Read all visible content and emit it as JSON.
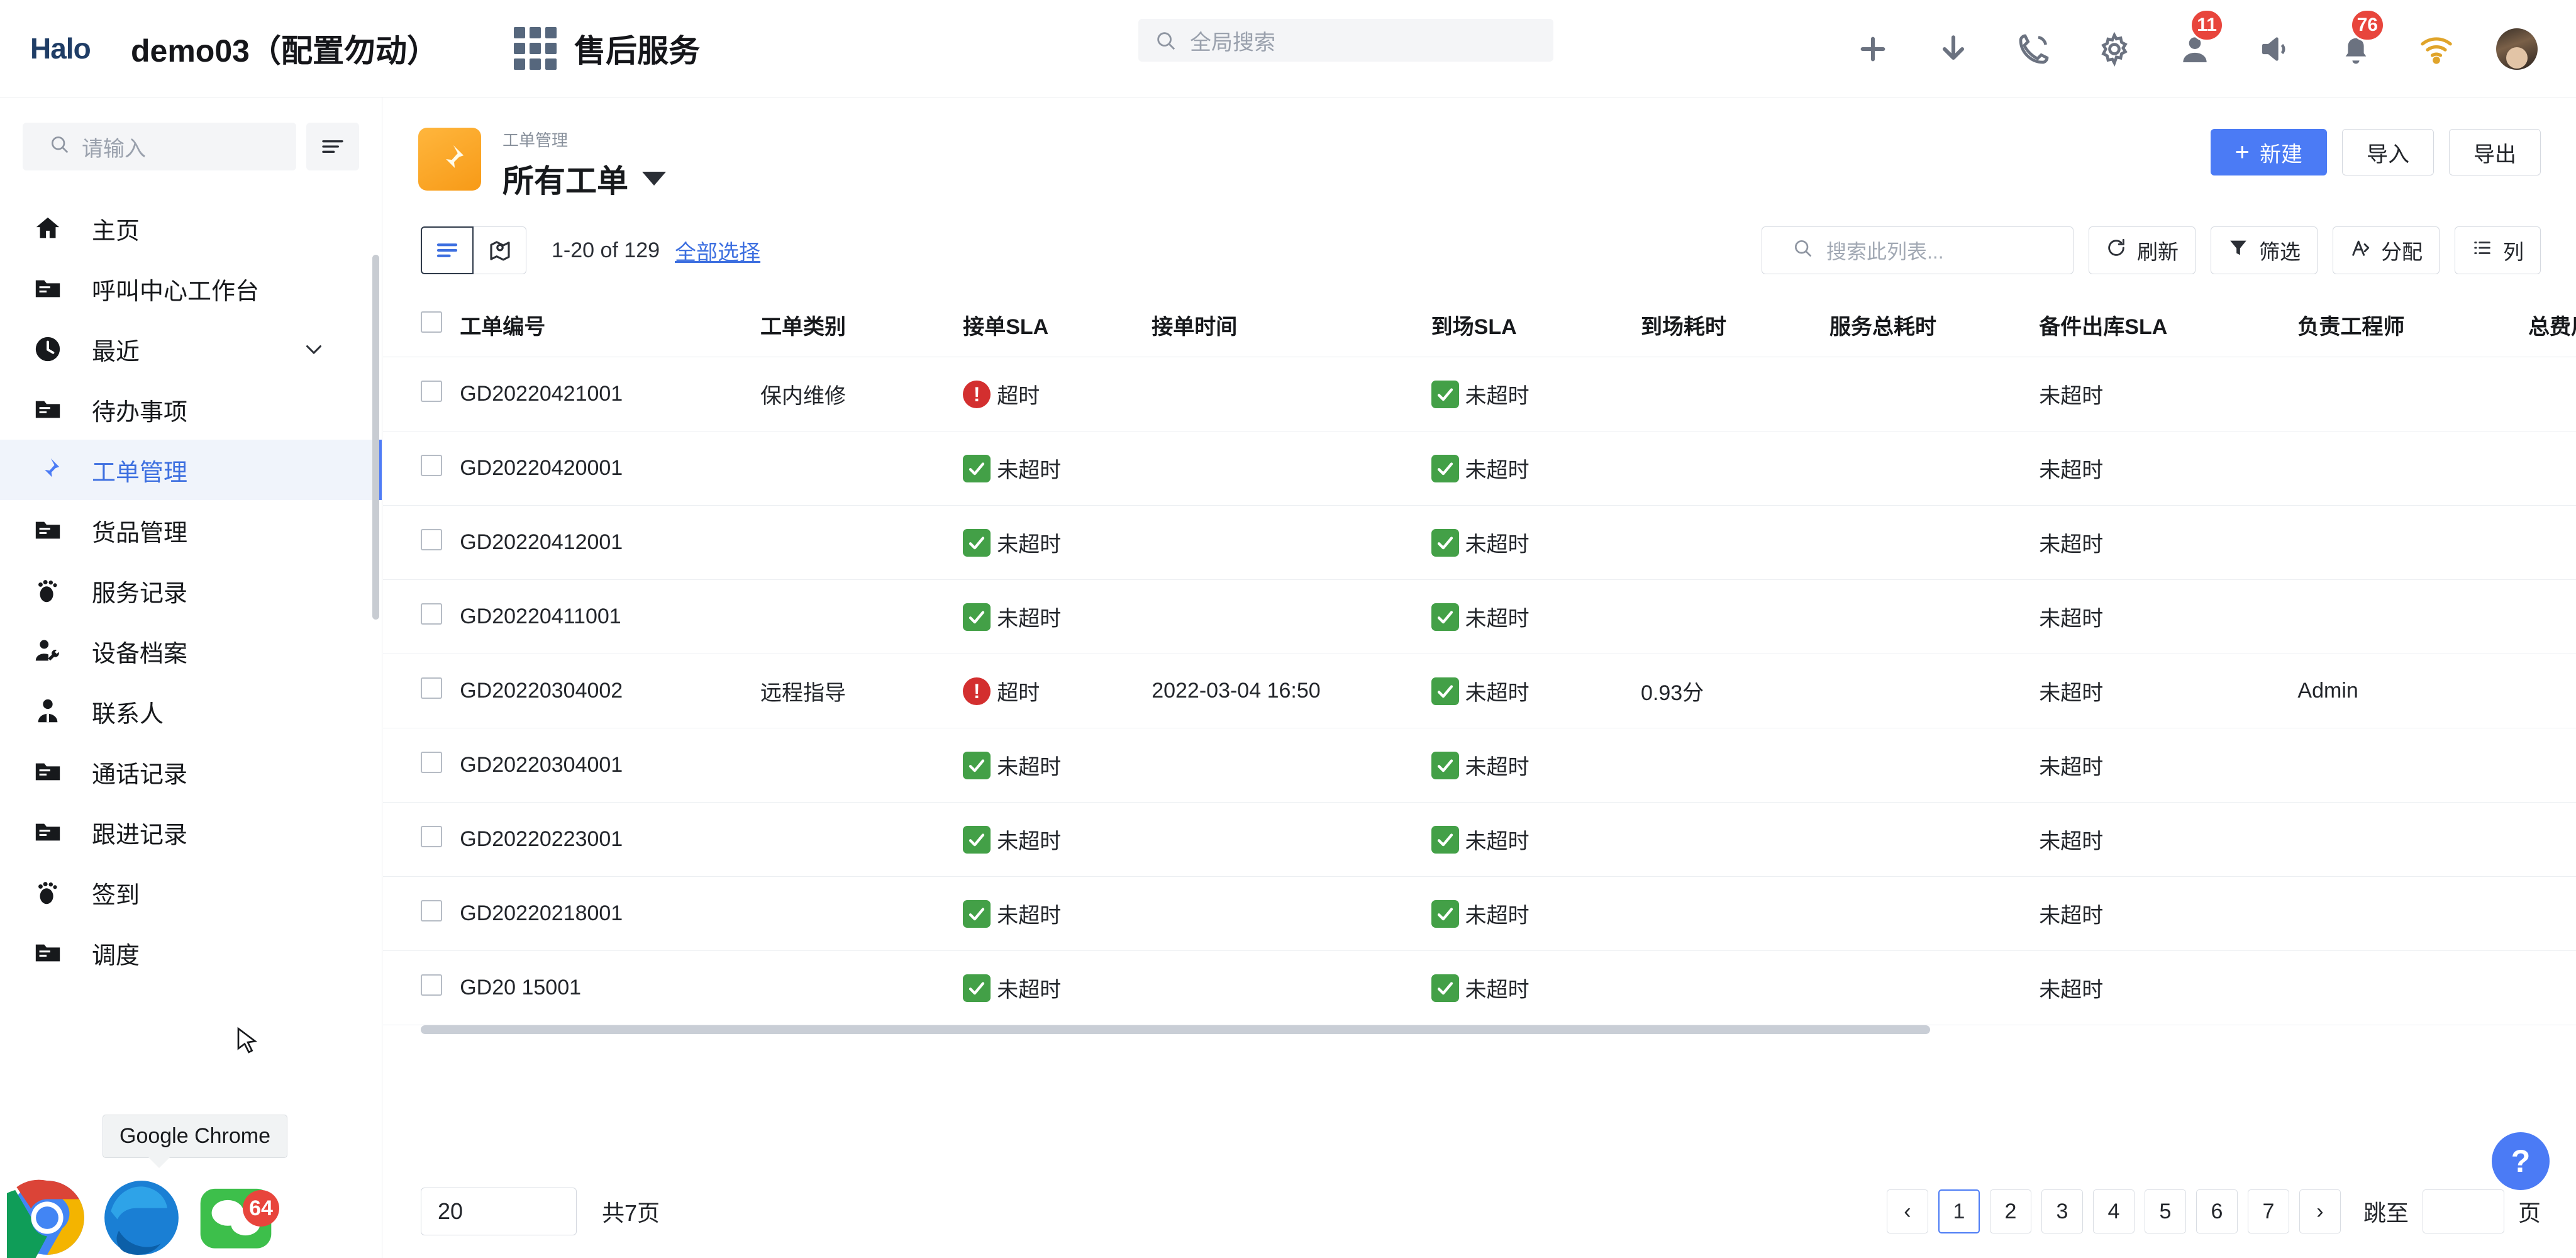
{
  "topbar": {
    "brand": "Halo",
    "tenant": "demo03（配置勿动）",
    "app_name": "售后服务",
    "app_grid_icon": "grid-icon",
    "search": {
      "placeholder": "全局搜索",
      "icon": "search-icon"
    },
    "actions": [
      {
        "name": "add-icon",
        "glyph": "plus",
        "badge": ""
      },
      {
        "name": "download-icon",
        "glyph": "download",
        "badge": ""
      },
      {
        "name": "phone-icon",
        "glyph": "phone",
        "badge": ""
      },
      {
        "name": "gear-icon",
        "glyph": "gear",
        "badge": ""
      },
      {
        "name": "agent-icon",
        "glyph": "agent",
        "badge": "11"
      },
      {
        "name": "speaker-icon",
        "glyph": "speaker",
        "badge": ""
      },
      {
        "name": "bell-icon",
        "glyph": "bell",
        "badge": "76"
      },
      {
        "name": "wifi-icon",
        "glyph": "wifi",
        "badge": ""
      }
    ],
    "avatar_label": "avatar"
  },
  "sidebar": {
    "search_placeholder": "请输入",
    "search_icon": "search-icon",
    "filter_icon": "filter-list-icon",
    "items": [
      {
        "label": "主页",
        "icon": "home-icon",
        "active": false,
        "expandable": false
      },
      {
        "label": "呼叫中心工作台",
        "icon": "folder-icon",
        "active": false,
        "expandable": false
      },
      {
        "label": "最近",
        "icon": "clock-icon",
        "active": false,
        "expandable": true
      },
      {
        "label": "待办事项",
        "icon": "folder-icon",
        "active": false,
        "expandable": false
      },
      {
        "label": "工单管理",
        "icon": "pin-icon",
        "active": true,
        "expandable": false
      },
      {
        "label": "货品管理",
        "icon": "folder-icon",
        "active": false,
        "expandable": false
      },
      {
        "label": "服务记录",
        "icon": "footprint-icon",
        "active": false,
        "expandable": false
      },
      {
        "label": "设备档案",
        "icon": "engineer-icon",
        "active": false,
        "expandable": false
      },
      {
        "label": "联系人",
        "icon": "person-icon",
        "active": false,
        "expandable": false
      },
      {
        "label": "通话记录",
        "icon": "folder-icon",
        "active": false,
        "expandable": false
      },
      {
        "label": "跟进记录",
        "icon": "folder-icon",
        "active": false,
        "expandable": false
      },
      {
        "label": "签到",
        "icon": "footprint-icon",
        "active": false,
        "expandable": false
      },
      {
        "label": "调度",
        "icon": "folder-icon",
        "active": false,
        "expandable": false
      }
    ]
  },
  "page": {
    "breadcrumb": "工单管理",
    "title": "所有工单",
    "title_icon": "pin-icon",
    "new_label": "新建",
    "import_label": "导入",
    "export_label": "导出"
  },
  "toolbar": {
    "view_list_icon": "list-view-icon",
    "view_map_icon": "map-view-icon",
    "count_text": "1-20 of 129",
    "select_all_label": "全部选择",
    "search_placeholder": "搜索此列表...",
    "refresh_label": "刷新",
    "filter_label": "筛选",
    "assign_label": "分配",
    "columns_label": "列"
  },
  "table": {
    "columns": [
      "工单编号",
      "工单类别",
      "接单SLA",
      "接单时间",
      "到场SLA",
      "到场耗时",
      "服务总耗时",
      "备件出库SLA",
      "负责工程师",
      "总费用"
    ],
    "rows": [
      {
        "id": "GD20220421001",
        "type": "保内维修",
        "sla1": "超时",
        "sla1_ok": false,
        "time": "",
        "sla2": "未超时",
        "sla2_ok": true,
        "dur": "",
        "total": "",
        "part": "未超时",
        "engineer": "",
        "fee": ""
      },
      {
        "id": "GD20220420001",
        "type": "",
        "sla1": "未超时",
        "sla1_ok": true,
        "time": "",
        "sla2": "未超时",
        "sla2_ok": true,
        "dur": "",
        "total": "",
        "part": "未超时",
        "engineer": "",
        "fee": ""
      },
      {
        "id": "GD20220412001",
        "type": "",
        "sla1": "未超时",
        "sla1_ok": true,
        "time": "",
        "sla2": "未超时",
        "sla2_ok": true,
        "dur": "",
        "total": "",
        "part": "未超时",
        "engineer": "",
        "fee": ""
      },
      {
        "id": "GD20220411001",
        "type": "",
        "sla1": "未超时",
        "sla1_ok": true,
        "time": "",
        "sla2": "未超时",
        "sla2_ok": true,
        "dur": "",
        "total": "",
        "part": "未超时",
        "engineer": "",
        "fee": ""
      },
      {
        "id": "GD20220304002",
        "type": "远程指导",
        "sla1": "超时",
        "sla1_ok": false,
        "time": "2022-03-04 16:50",
        "sla2": "未超时",
        "sla2_ok": true,
        "dur": "0.93分",
        "total": "",
        "part": "未超时",
        "engineer": "Admin",
        "fee": ""
      },
      {
        "id": "GD20220304001",
        "type": "",
        "sla1": "未超时",
        "sla1_ok": true,
        "time": "",
        "sla2": "未超时",
        "sla2_ok": true,
        "dur": "",
        "total": "",
        "part": "未超时",
        "engineer": "",
        "fee": ""
      },
      {
        "id": "GD20220223001",
        "type": "",
        "sla1": "未超时",
        "sla1_ok": true,
        "time": "",
        "sla2": "未超时",
        "sla2_ok": true,
        "dur": "",
        "total": "",
        "part": "未超时",
        "engineer": "",
        "fee": ""
      },
      {
        "id": "GD20220218001",
        "type": "",
        "sla1": "未超时",
        "sla1_ok": true,
        "time": "",
        "sla2": "未超时",
        "sla2_ok": true,
        "dur": "",
        "total": "",
        "part": "未超时",
        "engineer": "",
        "fee": ""
      },
      {
        "id": "GD20    15001",
        "type": "",
        "sla1": "未超时",
        "sla1_ok": true,
        "time": "",
        "sla2": "未超时",
        "sla2_ok": true,
        "dur": "",
        "total": "",
        "part": "未超时",
        "engineer": "",
        "fee": ""
      }
    ]
  },
  "footer": {
    "page_size": "20",
    "total_pages_text": "共7页",
    "prev_label": "‹",
    "next_label": "›",
    "pages": [
      "1",
      "2",
      "3",
      "4",
      "5",
      "6",
      "7"
    ],
    "current_page": "1",
    "jump_label": "跳至",
    "jump_value": "",
    "jump_unit": "页",
    "help_label": "?"
  },
  "desktop": {
    "tooltip": "Google Chrome",
    "dock": [
      {
        "name": "chrome-icon",
        "badge": ""
      },
      {
        "name": "edge-icon",
        "badge": ""
      },
      {
        "name": "wechat-icon",
        "badge": "64"
      }
    ]
  }
}
